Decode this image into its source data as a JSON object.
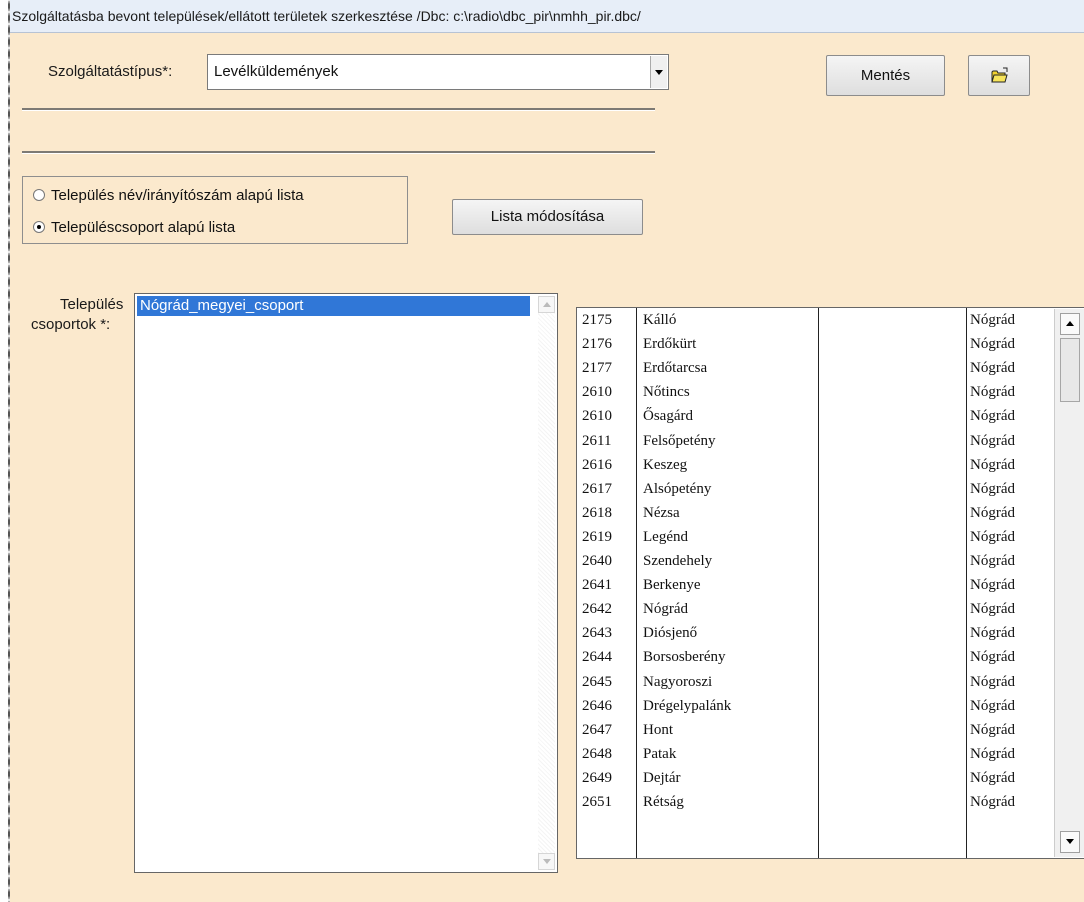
{
  "window": {
    "title": "Szolgáltatásba bevont települések/ellátott területek szerkesztése   /Dbc: c:\\radio\\dbc_pir\\nmhh_pir.dbc/"
  },
  "service": {
    "label": "Szolgáltatástípus*:",
    "value": "Levélküldemények"
  },
  "buttons": {
    "save": "Mentés",
    "modify_list": "Lista módosítása",
    "open_icon": "folder-open-icon"
  },
  "radio": {
    "option1": "Település név/irányítószám alapú lista",
    "option2": "Településcsoport alapú lista",
    "selected": 2
  },
  "groups": {
    "label_line1": "Település",
    "label_line2": "csoportok *:",
    "items": [
      "Nógrád_megyei_csoport"
    ],
    "selected_index": 0
  },
  "settlements": [
    {
      "zip": "2175",
      "name": "Kálló",
      "extra": "",
      "county": "Nógrád"
    },
    {
      "zip": "2176",
      "name": "Erdőkürt",
      "extra": "",
      "county": "Nógrád"
    },
    {
      "zip": "2177",
      "name": "Erdőtarcsa",
      "extra": "",
      "county": "Nógrád"
    },
    {
      "zip": "2610",
      "name": "Nőtincs",
      "extra": "",
      "county": "Nógrád"
    },
    {
      "zip": "2610",
      "name": "Ősagárd",
      "extra": "",
      "county": "Nógrád"
    },
    {
      "zip": "2611",
      "name": "Felsőpetény",
      "extra": "",
      "county": "Nógrád"
    },
    {
      "zip": "2616",
      "name": "Keszeg",
      "extra": "",
      "county": "Nógrád"
    },
    {
      "zip": "2617",
      "name": "Alsópetény",
      "extra": "",
      "county": "Nógrád"
    },
    {
      "zip": "2618",
      "name": "Nézsa",
      "extra": "",
      "county": "Nógrád"
    },
    {
      "zip": "2619",
      "name": "Legénd",
      "extra": "",
      "county": "Nógrád"
    },
    {
      "zip": "2640",
      "name": "Szendehely",
      "extra": "",
      "county": "Nógrád"
    },
    {
      "zip": "2641",
      "name": "Berkenye",
      "extra": "",
      "county": "Nógrád"
    },
    {
      "zip": "2642",
      "name": "Nógrád",
      "extra": "",
      "county": "Nógrád"
    },
    {
      "zip": "2643",
      "name": "Diósjenő",
      "extra": "",
      "county": "Nógrád"
    },
    {
      "zip": "2644",
      "name": "Borsosberény",
      "extra": "",
      "county": "Nógrád"
    },
    {
      "zip": "2645",
      "name": "Nagyoroszi",
      "extra": "",
      "county": "Nógrád"
    },
    {
      "zip": "2646",
      "name": "Drégelypalánk",
      "extra": "",
      "county": "Nógrád"
    },
    {
      "zip": "2647",
      "name": "Hont",
      "extra": "",
      "county": "Nógrád"
    },
    {
      "zip": "2648",
      "name": "Patak",
      "extra": "",
      "county": "Nógrád"
    },
    {
      "zip": "2649",
      "name": "Dejtár",
      "extra": "",
      "county": "Nógrád"
    },
    {
      "zip": "2651",
      "name": "Rétság",
      "extra": "",
      "county": "Nógrád"
    }
  ],
  "colors": {
    "background": "#fbe9cd",
    "selection": "#3077d7",
    "titlebar": "#e7eef8"
  }
}
